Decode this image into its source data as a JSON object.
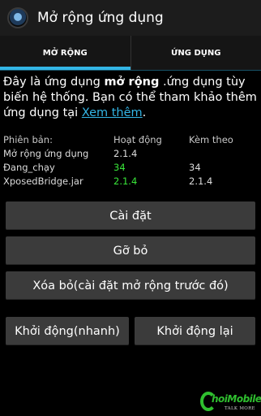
{
  "app": {
    "title": "Mở rộng ứng dụng",
    "icon": "xposed-app-icon"
  },
  "tabs": [
    {
      "label": "MỞ RỘNG",
      "active": true
    },
    {
      "label": "ỨNG DỤNG",
      "active": false
    }
  ],
  "description": {
    "part1": "Đây là ứng dụng ",
    "bold": "mở rộng",
    "part2": " .ứng dụng tùy biến hệ thống. Bạn có thể tham khảo thêm ứng dụng tại ",
    "link": "Xem thêm",
    "end": "."
  },
  "versions": {
    "headers": [
      "Phiên bản:",
      "Hoạt động",
      "Kèm theo"
    ],
    "rows": [
      [
        "Mở rộng ứng dụng",
        "2.1.4",
        ""
      ],
      [
        "Đang_chạy",
        "34",
        "34"
      ],
      [
        "XposedBridge.jar",
        "2.1.4",
        "2.1.4"
      ]
    ],
    "active_color": "#39e639"
  },
  "buttons": {
    "install": "Cài đặt",
    "uninstall": "Gỡ bỏ",
    "remove": "Xóa bỏ(cài đặt mở rộng trước đó)",
    "soft_reboot": "Khởi động(nhanh)",
    "reboot": "Khởi động lại"
  },
  "watermark": {
    "mobile": "hoiMobile",
    "tagline": "TALK MORE"
  },
  "colors": {
    "accent": "#33b5e5",
    "button": "#3b3b3b",
    "actionbar": "#1c1c1c"
  }
}
